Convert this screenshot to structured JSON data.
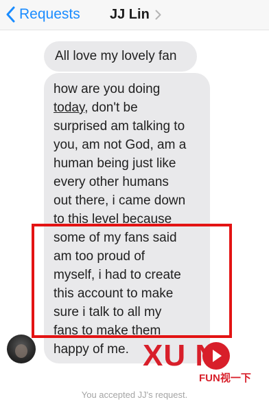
{
  "header": {
    "back_label": "Requests",
    "title": "JJ Lin"
  },
  "messages": [
    {
      "lines": [
        "All love my lovely fan"
      ]
    },
    {
      "lines": [
        "how are you doing",
        "today, don't be",
        "surprised am talking to",
        "you, am not God, am a",
        "human being just like",
        "every other humans",
        "out there, i came down",
        "to this level because",
        "some of my fans said",
        "am too proud of",
        "myself, i had to create",
        "this account to make",
        "sure i talk to all my",
        "fans to make them",
        "happy of me."
      ],
      "line2_underlined_word": "today",
      "line2_rest": ", don't be"
    }
  ],
  "status_text": "You accepted JJ's request.",
  "watermark": {
    "brand": "XU  N",
    "sub": "FUN视一下"
  },
  "colors": {
    "accent": "#1a8cff",
    "bubble": "#e9e9eb",
    "highlight": "#e31313",
    "watermark": "#d81f2a"
  },
  "icons": [
    "back-chevron-icon",
    "title-chevron-icon",
    "play-icon"
  ]
}
